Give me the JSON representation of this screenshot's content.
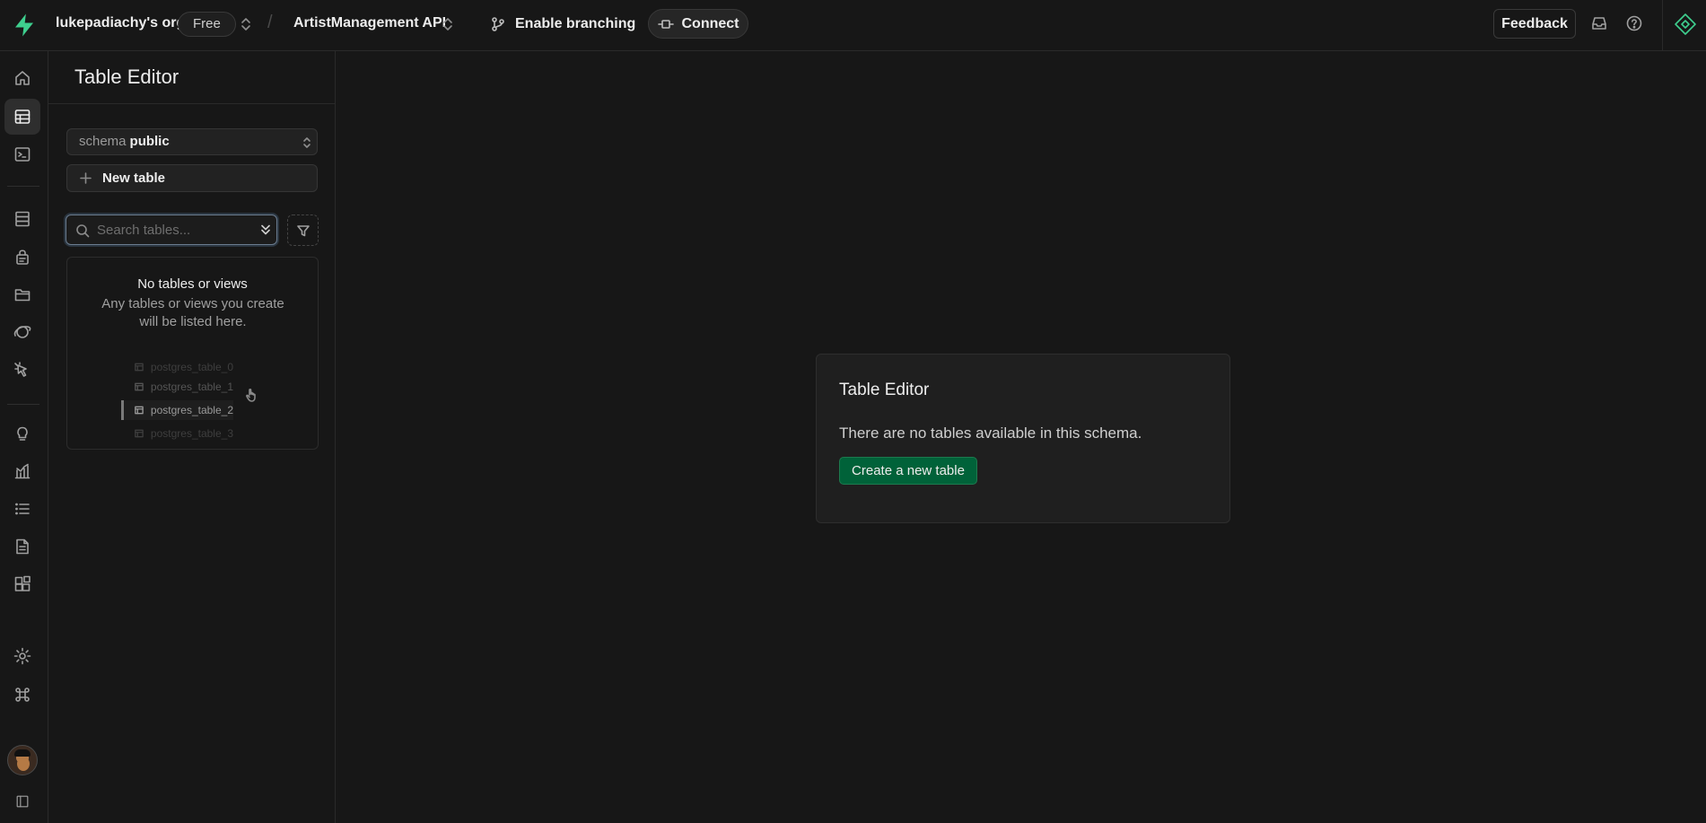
{
  "topbar": {
    "org_name": "lukepadiachy's org",
    "plan": "Free",
    "separator": "/",
    "project_name": "ArtistManagement API",
    "branching_label": "Enable branching",
    "connect_label": "Connect",
    "feedback_label": "Feedback"
  },
  "rail": {
    "icons": [
      "home-icon",
      "table-editor-icon",
      "sql-editor-icon",
      "database-icon",
      "auth-icon",
      "storage-icon",
      "realtime-icon",
      "edge-functions-icon",
      "advisors-icon",
      "reports-icon",
      "logs-icon",
      "api-docs-icon",
      "integrations-icon",
      "settings-icon",
      "command-icon",
      "avatar",
      "collapse-sidebar-icon"
    ],
    "active": "table-editor-icon"
  },
  "side": {
    "title": "Table Editor",
    "schema_key": "schema",
    "schema_value": "public",
    "new_table_label": "New table",
    "search_placeholder": "Search tables...",
    "empty_title": "No tables or views",
    "empty_desc": "Any tables or views you create will be listed here.",
    "ghost_tables": [
      "postgres_table_0",
      "postgres_table_1",
      "postgres_table_2",
      "postgres_table_3"
    ]
  },
  "main": {
    "card_title": "Table Editor",
    "card_text": "There are no tables available in this schema.",
    "create_button": "Create a new table"
  },
  "colors": {
    "brand": "#3ecf8e",
    "primary_button": "#006239",
    "annotation_arrow": "#a3e635",
    "background": "#171717"
  }
}
